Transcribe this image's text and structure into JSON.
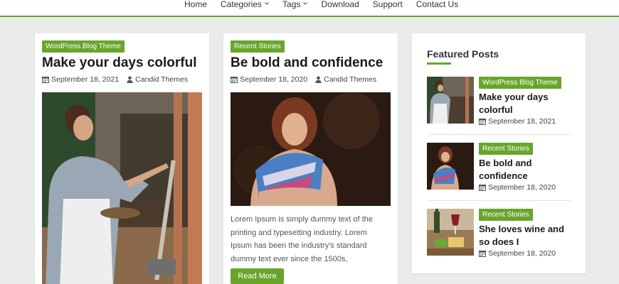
{
  "nav": {
    "items": [
      "Home",
      "Categories",
      "Tags",
      "Download",
      "Support",
      "Contact Us"
    ]
  },
  "posts": [
    {
      "category": "WordPress Blog Theme",
      "title": "Make your days colorful",
      "date": "September 18, 2021",
      "author": "Candid Themes",
      "image": "woman-painting-at-easel"
    },
    {
      "category": "Recent Stories",
      "title": "Be bold and confidence",
      "date": "September 18, 2020",
      "author": "Candid Themes",
      "image": "woman-with-colorful-scarf",
      "excerpt": "Lorem Ipsum is simply dummy text of the printing and typesetting industry. Lorem Ipsum has been the industry's standard dummy text ever since the 1500s,",
      "button": "Read More"
    }
  ],
  "featured": {
    "heading": "Featured Posts",
    "items": [
      {
        "category": "WordPress Blog Theme",
        "title": "Make your days colorful",
        "date": "September 18, 2021",
        "image": "woman-painting-thumb"
      },
      {
        "category": "Recent Stories",
        "title": "Be bold and confidence",
        "date": "September 18, 2020",
        "image": "woman-scarf-thumb"
      },
      {
        "category": "Recent Stories",
        "title": "She loves wine and so does I",
        "date": "September 18, 2020",
        "image": "wine-and-cheese-thumb"
      }
    ]
  },
  "colors": {
    "accent": "#69a52c",
    "background": "#e9ecea"
  }
}
